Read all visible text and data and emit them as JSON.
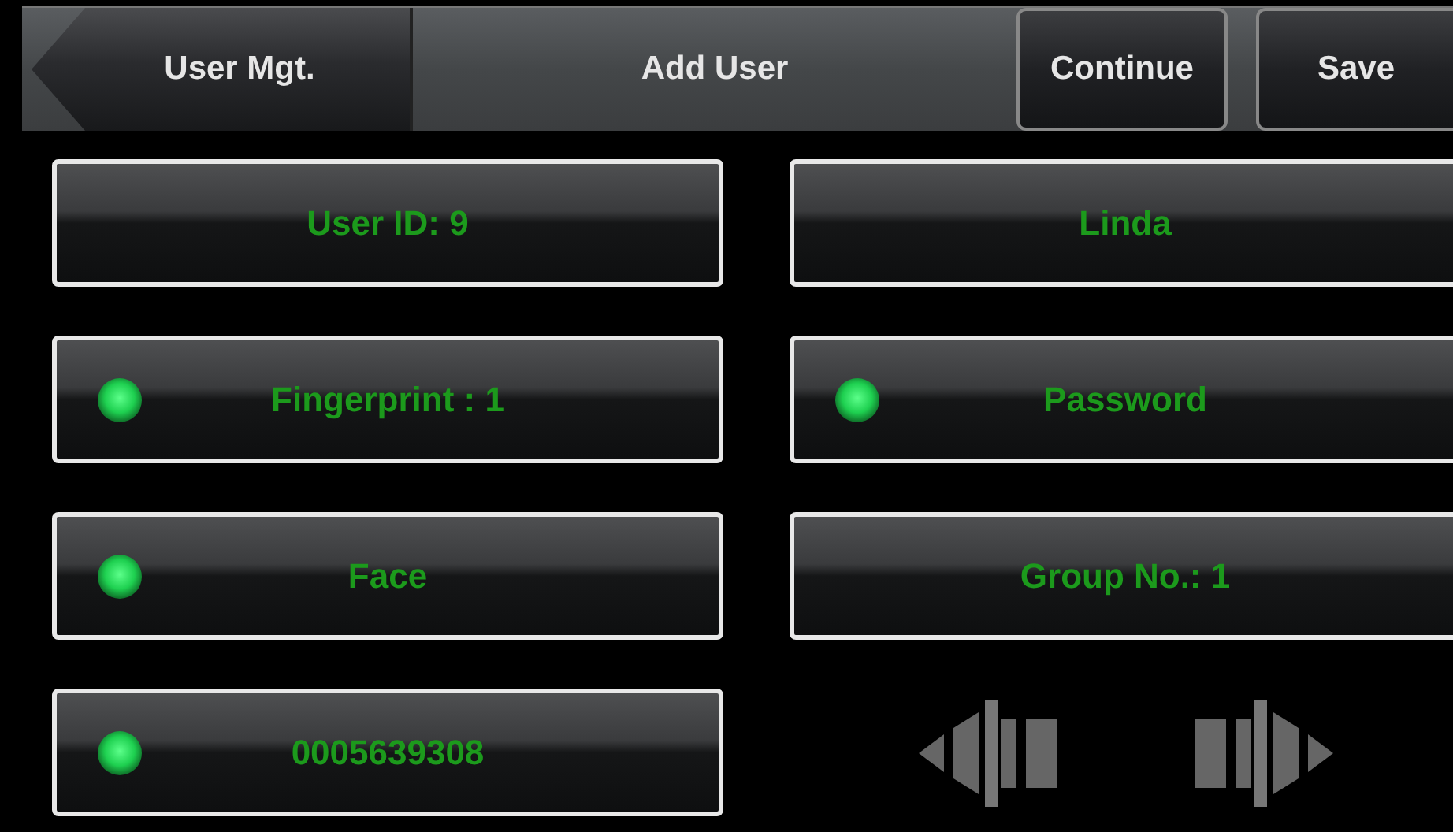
{
  "header": {
    "back": "User Mgt.",
    "title": "Add User",
    "buttons": [
      "Continue",
      "Save"
    ]
  },
  "fields": [
    {
      "label": "User ID: 9",
      "indicator": false
    },
    {
      "label": "Linda",
      "indicator": false
    },
    {
      "label": "Fingerprint : 1",
      "indicator": true
    },
    {
      "label": "Password",
      "indicator": true
    },
    {
      "label": "Face",
      "indicator": true
    },
    {
      "label": "Group No.: 1",
      "indicator": false
    },
    {
      "label": "0005639308",
      "indicator": true
    }
  ]
}
